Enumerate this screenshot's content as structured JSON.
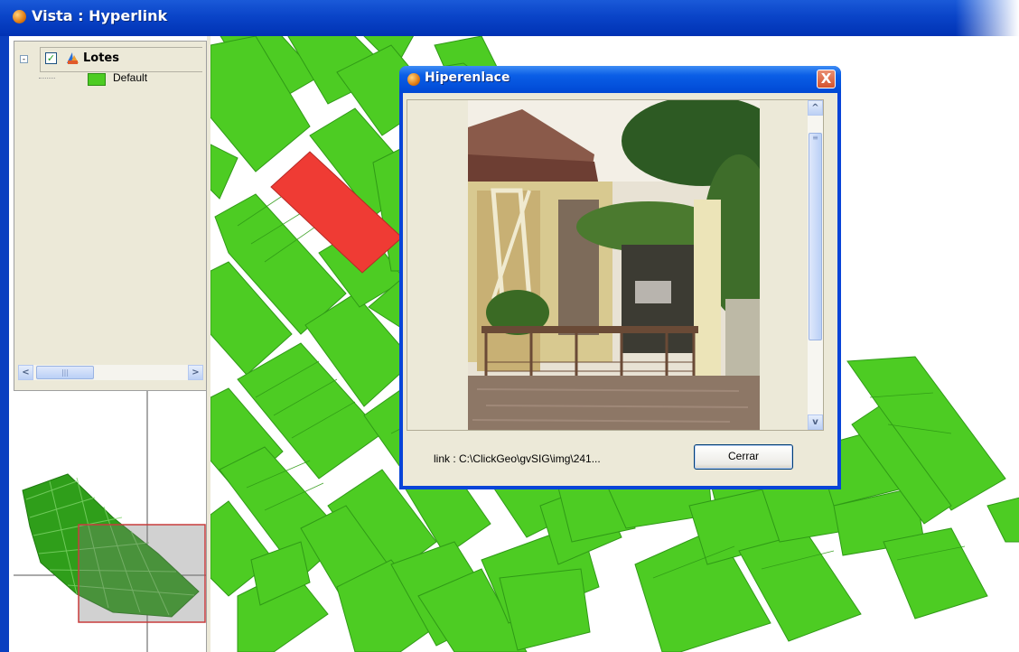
{
  "window": {
    "title": "Vista : Hyperlink",
    "icon": "gvsig-app-icon"
  },
  "toc": {
    "layer": {
      "name": "Lotes",
      "checked": true,
      "check_glyph": "✓",
      "expander_glyph": "-",
      "icon": "polygon-layer-icon"
    },
    "legend": [
      {
        "label": "Default",
        "color": "#4dcc23"
      }
    ],
    "scrollbar": {
      "left_arrow": "<",
      "right_arrow": ">",
      "thumb_grip": "|||"
    }
  },
  "overview": {
    "extent_color": "#c83c3c",
    "lot_color": "#2f9e1a"
  },
  "map": {
    "lot_color": "#4dcc23",
    "lot_border": "#2f9a16",
    "selected_lot_color": "#ef3b34",
    "background": "#ffffff"
  },
  "dialog": {
    "title": "Hiperenlace",
    "close_glyph": "X",
    "link_text": "link : C:\\ClickGeo\\gvSIG\\img\\241...",
    "close_button_label": "Cerrar",
    "scrollbar": {
      "up_arrow": "^",
      "down_arrow": "v",
      "thumb_grip": "≡"
    },
    "image_subject": "flooded-house-photo"
  }
}
